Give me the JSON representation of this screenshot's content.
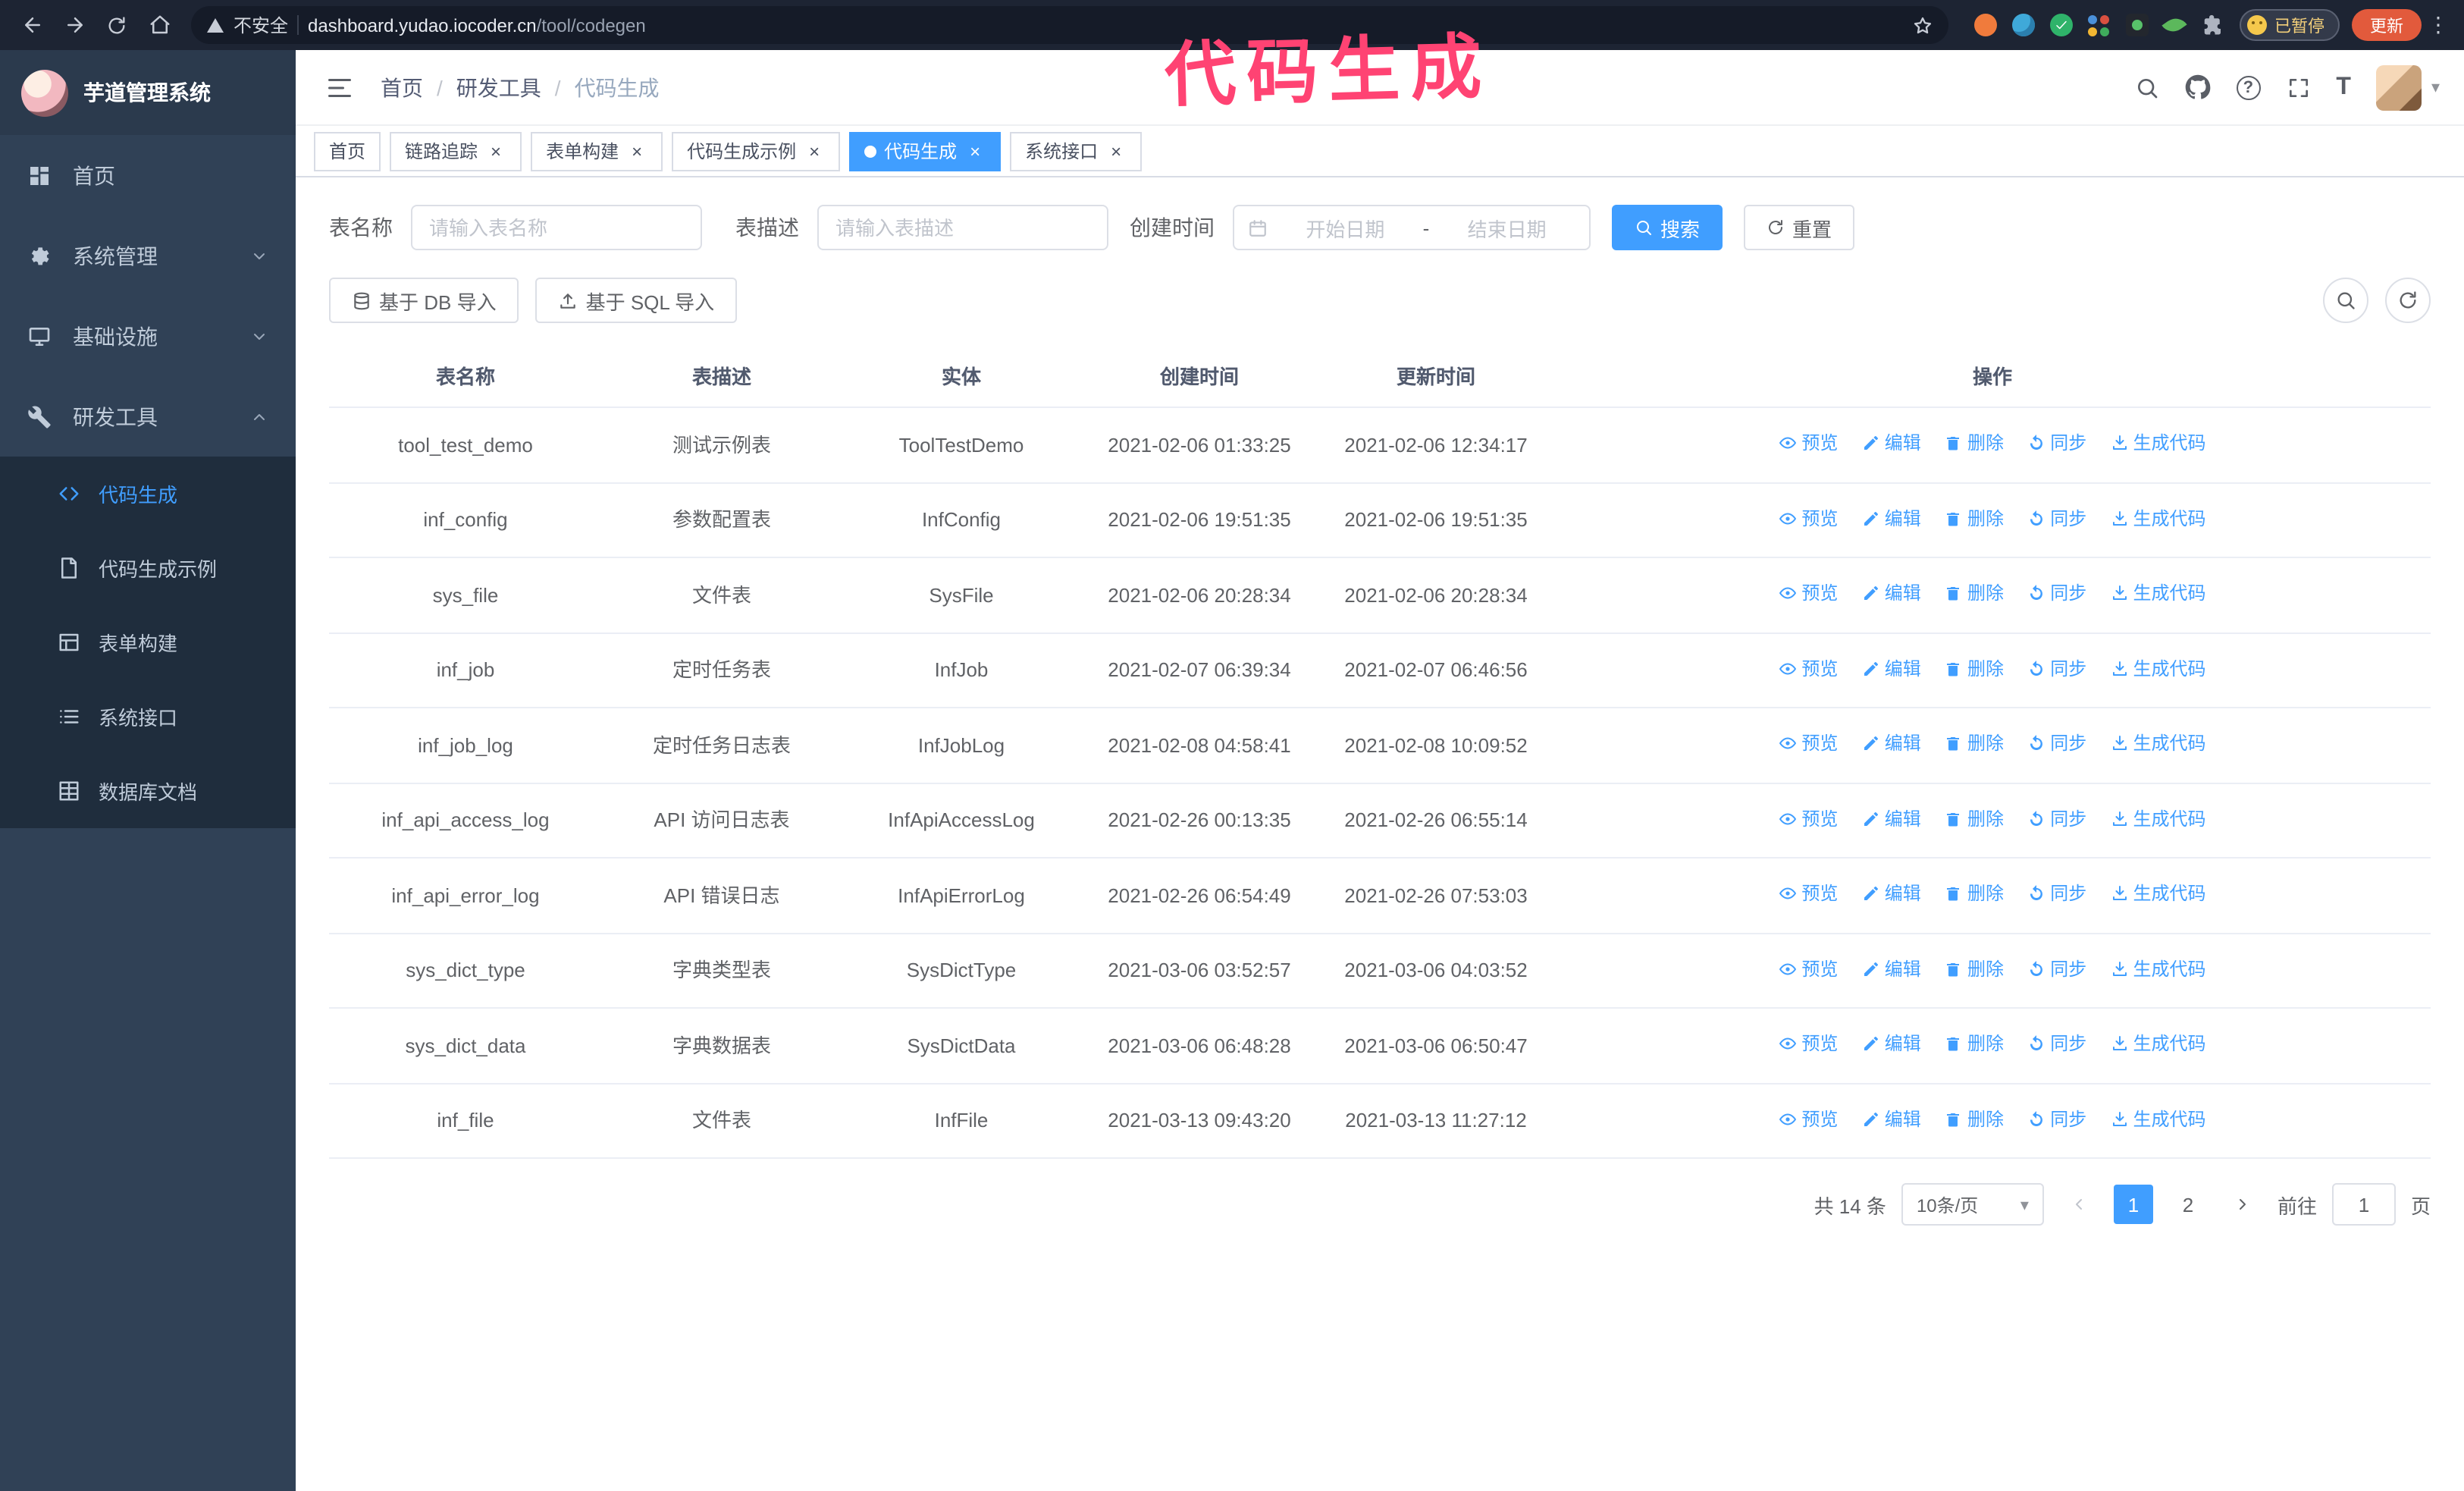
{
  "annotation": {
    "text": "代码生成",
    "color": "#ff4373"
  },
  "browser": {
    "security_label": "不安全",
    "url_host": "dashboard.yudao.iocoder.cn",
    "url_path": "/tool/codegen",
    "paused_badge": "已暂停",
    "update_button": "更新"
  },
  "sidebar": {
    "logo_title": "芋道管理系统",
    "items": [
      {
        "label": "首页"
      },
      {
        "label": "系统管理"
      },
      {
        "label": "基础设施"
      },
      {
        "label": "研发工具"
      }
    ],
    "subitems": [
      {
        "label": "代码生成"
      },
      {
        "label": "代码生成示例"
      },
      {
        "label": "表单构建"
      },
      {
        "label": "系统接口"
      },
      {
        "label": "数据库文档"
      }
    ]
  },
  "header": {
    "breadcrumb": [
      "首页",
      "研发工具",
      "代码生成"
    ]
  },
  "tags": [
    {
      "label": "首页"
    },
    {
      "label": "链路追踪"
    },
    {
      "label": "表单构建"
    },
    {
      "label": "代码生成示例"
    },
    {
      "label": "代码生成"
    },
    {
      "label": "系统接口"
    }
  ],
  "filters": {
    "table_name_label": "表名称",
    "table_name_placeholder": "请输入表名称",
    "table_desc_label": "表描述",
    "table_desc_placeholder": "请输入表描述",
    "create_time_label": "创建时间",
    "date_start_placeholder": "开始日期",
    "date_separator": "-",
    "date_end_placeholder": "结束日期",
    "search_button": "搜索",
    "reset_button": "重置"
  },
  "toolbar": {
    "import_db_label": "基于 DB 导入",
    "import_sql_label": "基于 SQL 导入"
  },
  "table": {
    "columns": [
      "表名称",
      "表描述",
      "实体",
      "创建时间",
      "更新时间",
      "操作"
    ],
    "actions": [
      "预览",
      "编辑",
      "删除",
      "同步",
      "生成代码"
    ],
    "rows": [
      {
        "name": "tool_test_demo",
        "desc": "测试示例表",
        "entity": "ToolTestDemo",
        "created": "2021-02-06 01:33:25",
        "updated": "2021-02-06 12:34:17"
      },
      {
        "name": "inf_config",
        "desc": "参数配置表",
        "entity": "InfConfig",
        "created": "2021-02-06 19:51:35",
        "updated": "2021-02-06 19:51:35"
      },
      {
        "name": "sys_file",
        "desc": "文件表",
        "entity": "SysFile",
        "created": "2021-02-06 20:28:34",
        "updated": "2021-02-06 20:28:34"
      },
      {
        "name": "inf_job",
        "desc": "定时任务表",
        "entity": "InfJob",
        "created": "2021-02-07 06:39:34",
        "updated": "2021-02-07 06:46:56"
      },
      {
        "name": "inf_job_log",
        "desc": "定时任务日志表",
        "entity": "InfJobLog",
        "created": "2021-02-08 04:58:41",
        "updated": "2021-02-08 10:09:52"
      },
      {
        "name": "inf_api_access_log",
        "desc": "API 访问日志表",
        "entity": "InfApiAccessLog",
        "created": "2021-02-26 00:13:35",
        "updated": "2021-02-26 06:55:14"
      },
      {
        "name": "inf_api_error_log",
        "desc": "API 错误日志",
        "entity": "InfApiErrorLog",
        "created": "2021-02-26 06:54:49",
        "updated": "2021-02-26 07:53:03"
      },
      {
        "name": "sys_dict_type",
        "desc": "字典类型表",
        "entity": "SysDictType",
        "created": "2021-03-06 03:52:57",
        "updated": "2021-03-06 04:03:52"
      },
      {
        "name": "sys_dict_data",
        "desc": "字典数据表",
        "entity": "SysDictData",
        "created": "2021-03-06 06:48:28",
        "updated": "2021-03-06 06:50:47"
      },
      {
        "name": "inf_file",
        "desc": "文件表",
        "entity": "InfFile",
        "created": "2021-03-13 09:43:20",
        "updated": "2021-03-13 11:27:12"
      }
    ]
  },
  "pagination": {
    "total": "共 14 条",
    "page_size": "10条/页",
    "pages": [
      "1",
      "2"
    ],
    "current": "1",
    "goto_label": "前往",
    "goto_value": "1",
    "goto_suffix": "页"
  },
  "icons": {
    "caret_down": "▾",
    "overflow_menu": "⋮",
    "close": "×",
    "breadcrumb_separator": "/",
    "question_mark": "?",
    "font_size_glyph": "T"
  }
}
